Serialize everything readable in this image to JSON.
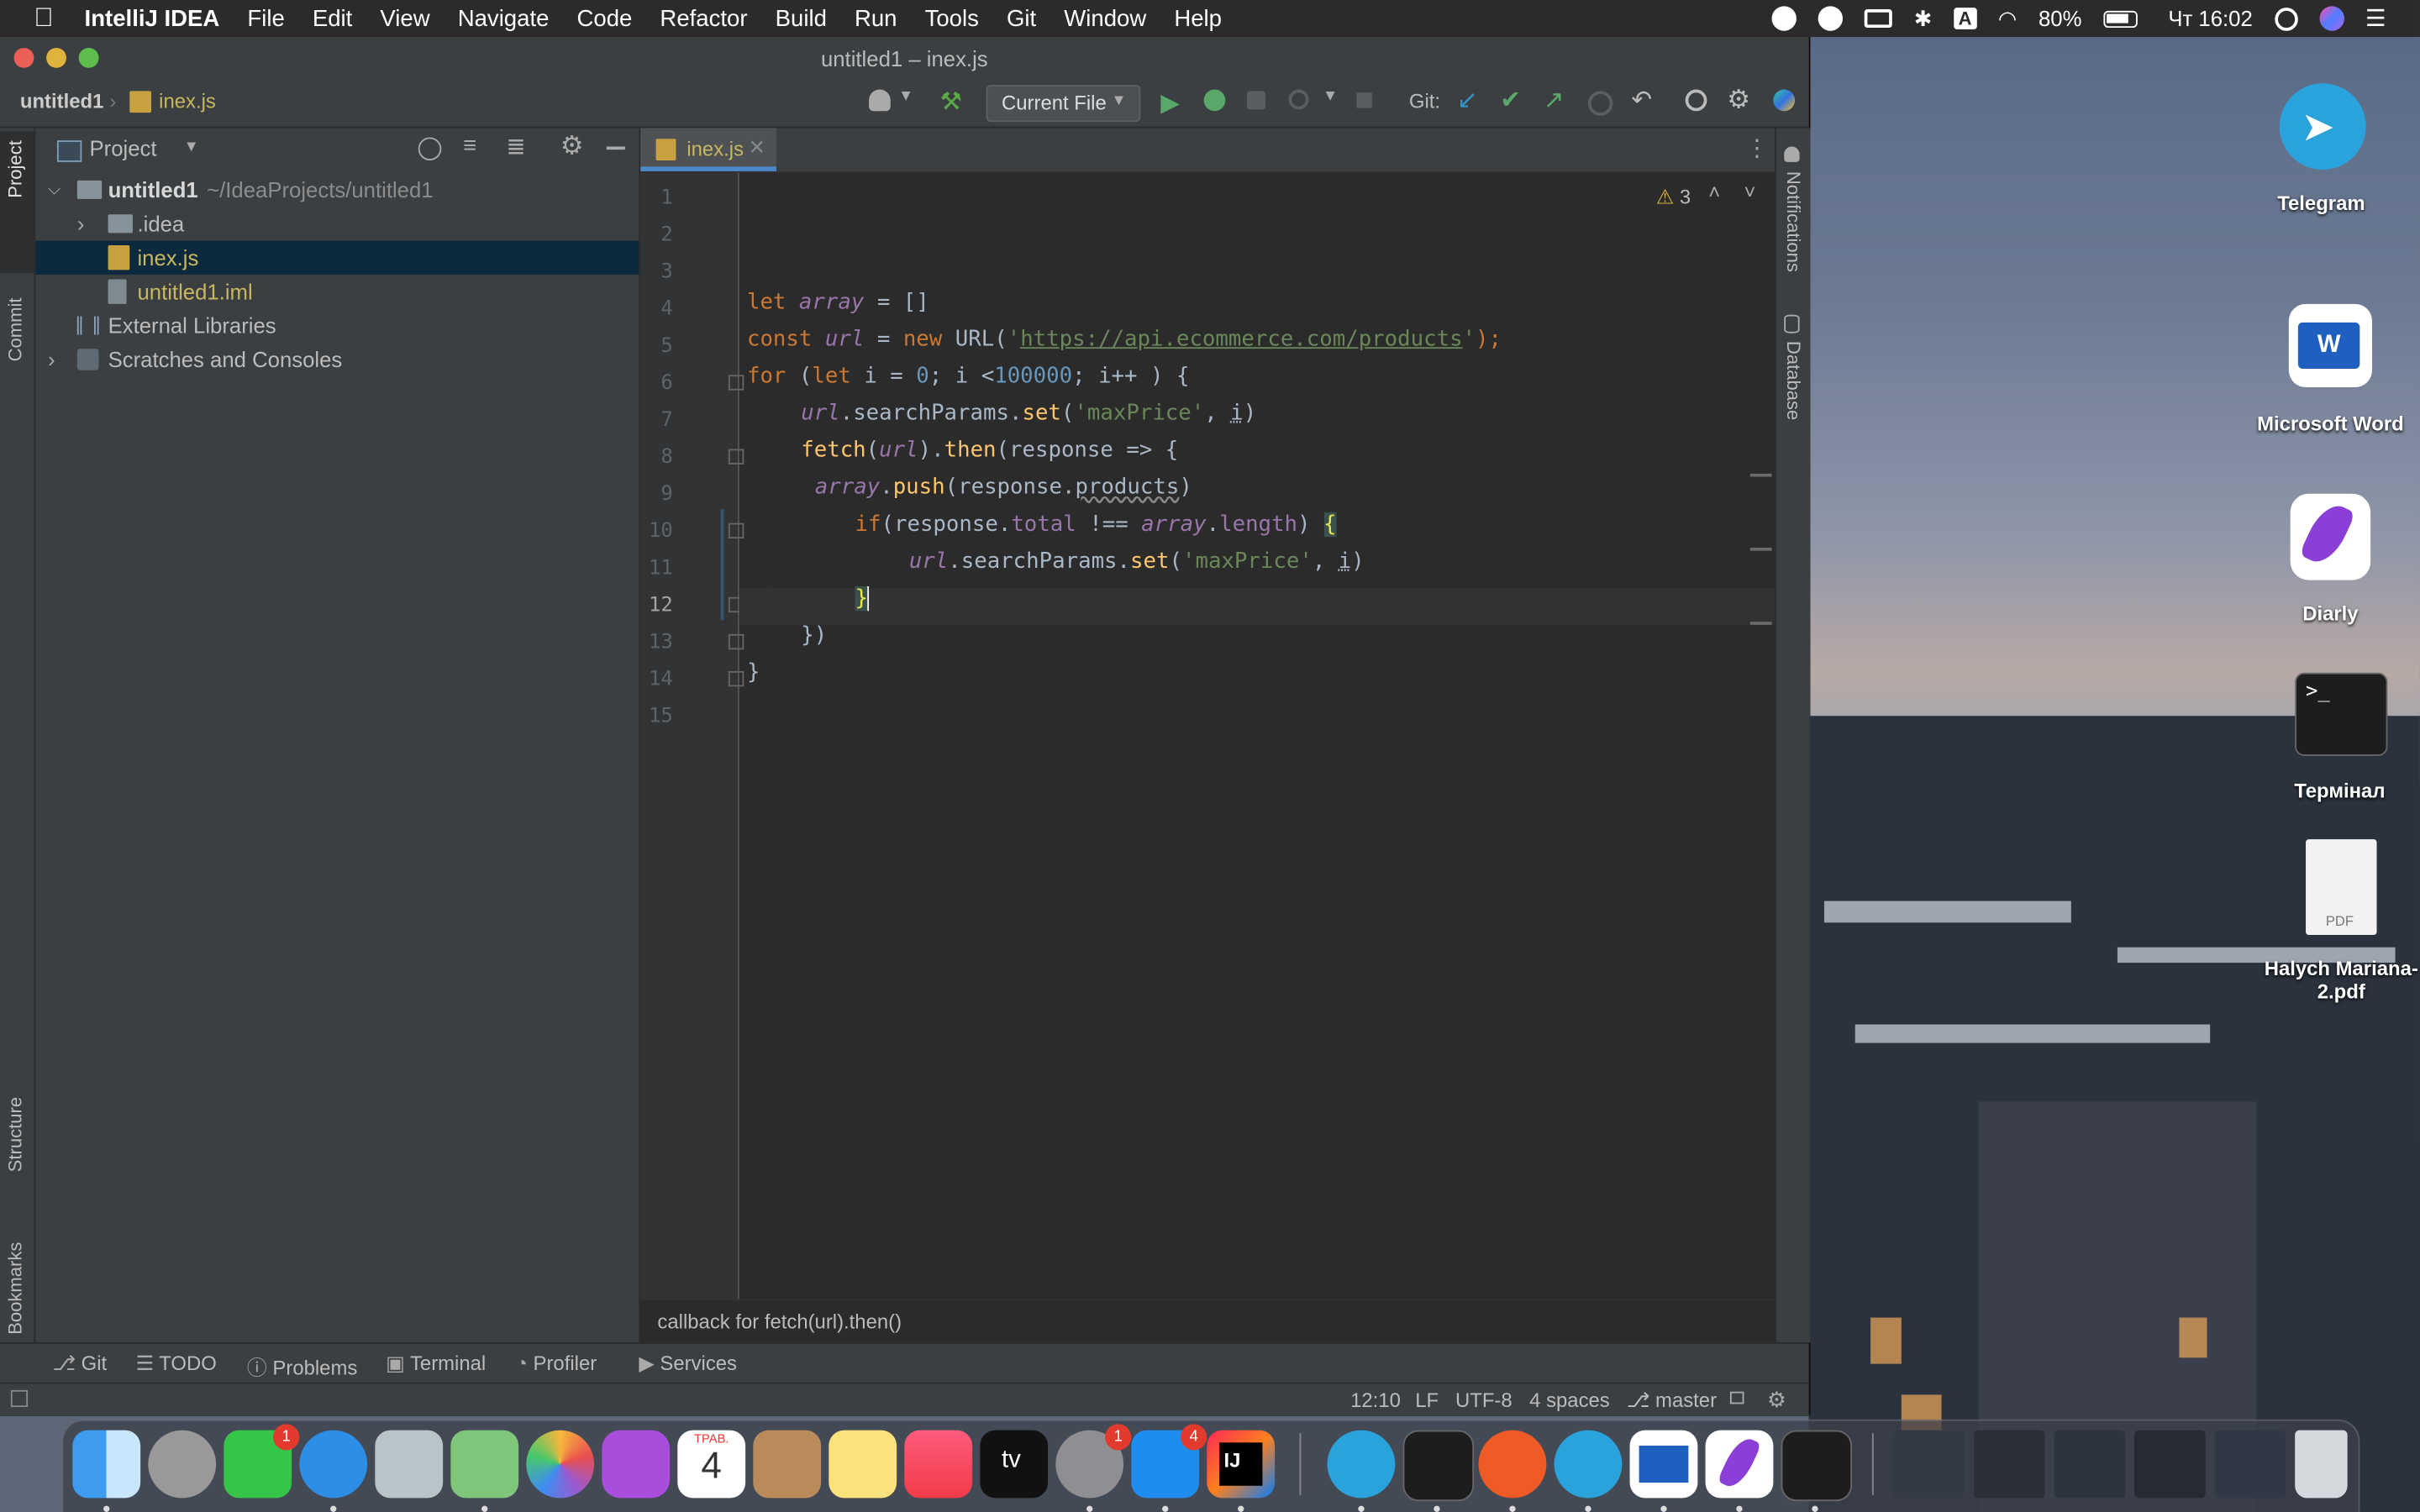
{
  "menubar": {
    "app_name": "IntelliJ IDEA",
    "items": [
      "File",
      "Edit",
      "View",
      "Navigate",
      "Code",
      "Refactor",
      "Build",
      "Run",
      "Tools",
      "Git",
      "Window",
      "Help"
    ],
    "battery": "80%",
    "datetime": "Чт 16:02",
    "keyboard_layout": "A"
  },
  "window": {
    "title": "untitled1 – inex.js",
    "breadcrumb_project": "untitled1",
    "breadcrumb_file": "inex.js",
    "run_config": "Current File",
    "git_label": "Git:"
  },
  "left_tool_tabs": [
    "Project",
    "Commit",
    "Structure",
    "Bookmarks"
  ],
  "right_tool_tabs": [
    "Notifications",
    "Database"
  ],
  "project_panel": {
    "title": "Project",
    "root_name": "untitled1",
    "root_path": "~/IdeaProjects/untitled1",
    "items": [
      {
        "label": ".idea",
        "type": "folder"
      },
      {
        "label": "inex.js",
        "type": "js"
      },
      {
        "label": "untitled1.iml",
        "type": "iml"
      }
    ],
    "external_libraries": "External Libraries",
    "scratches": "Scratches and Consoles"
  },
  "editor": {
    "tab_label": "inex.js",
    "warning_count": "3",
    "line_numbers": [
      "1",
      "2",
      "3",
      "4",
      "5",
      "6",
      "7",
      "8",
      "9",
      "10",
      "11",
      "12",
      "13",
      "14",
      "15"
    ],
    "lines": {
      "l4": {
        "kw": "let",
        "var": "array",
        "rest": " = []"
      },
      "l5": {
        "kw1": "const",
        "var": "url",
        "op": " = ",
        "kw2": "new",
        "cls": " URL(",
        "str_q1": "'",
        "url": "https://api.ecommerce.com/products",
        "str_q2": "'",
        "end": ");"
      },
      "l6": {
        "kw": "for",
        "a": " (",
        "kw2": "let",
        "b": " i = ",
        "n0": "0",
        "c": "; i <",
        "n1": "100000",
        "d": "; i++ ) {"
      },
      "l7": {
        "var": "url",
        "a": ".searchParams.",
        "fn": "set",
        "b": "(",
        "str": "'maxPrice'",
        "c": ", ",
        "i": "i",
        "d": ")"
      },
      "l8": {
        "fn": "fetch",
        "a": "(",
        "var": "url",
        "b": ").",
        "fn2": "then",
        "c": "(response => {"
      },
      "l9": {
        "var": "array",
        "a": ".",
        "fn": "push",
        "b": "(response.",
        "p": "products",
        "c": ")"
      },
      "l10": {
        "kw": "if",
        "a": "(response.",
        "p1": "total",
        "b": " !== ",
        "var": "array",
        "c": ".",
        "p2": "length",
        "d": ") ",
        "br": "{"
      },
      "l11": {
        "var": "url",
        "a": ".searchParams.",
        "fn": "set",
        "b": "(",
        "str": "'maxPrice'",
        "c": ", ",
        "i": "i",
        "d": ")"
      },
      "l12": {
        "br": "}"
      },
      "l13": {
        "t": "})"
      },
      "l14": {
        "t": "}"
      }
    },
    "breadcrumb_hint": "callback for fetch(url).then()"
  },
  "bottom_tools": [
    "Git",
    "TODO",
    "Problems",
    "Terminal",
    "Profiler",
    "Services"
  ],
  "statusbar": {
    "position": "12:10",
    "line_sep": "LF",
    "encoding": "UTF-8",
    "indent": "4 spaces",
    "branch": "master"
  },
  "desktop_icons": [
    "Telegram",
    "Microsoft Word",
    "Diarly",
    "Термінал",
    "Halych Mariana-2.pdf"
  ],
  "desktop_pdf_tag": "PDF",
  "dock": {
    "badges": {
      "facetime": "1",
      "settings": "1",
      "appstore": "4"
    },
    "calendar_month": "ТРАВ.",
    "calendar_day": "4",
    "appletv_label": "tv",
    "ij_label": "IJ"
  },
  "colors": {
    "editor_bg": "#2b2b2b",
    "panel_bg": "#3c3f41",
    "keyword": "#cc7832",
    "string": "#6a8759",
    "number": "#6897bb",
    "function": "#ffc66d",
    "instance_var": "#9876aa"
  }
}
